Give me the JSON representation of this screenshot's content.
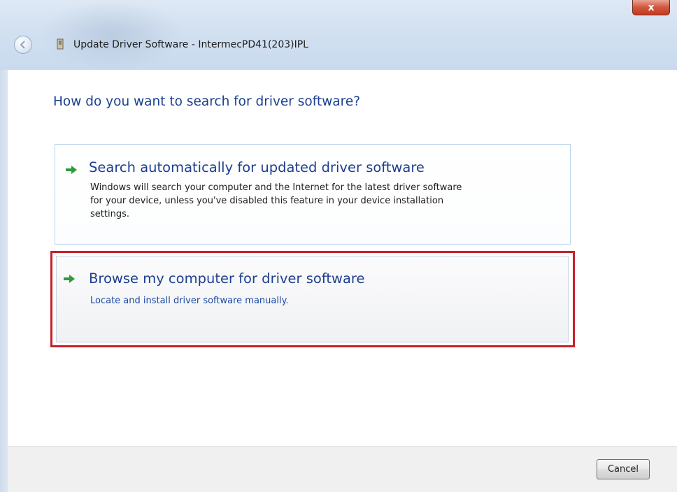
{
  "window": {
    "title": "Update Driver Software - IntermecPD41(203)IPL",
    "close_label": "x"
  },
  "main": {
    "heading": "How do you want to search for driver software?",
    "options": [
      {
        "title": "Search automatically for updated driver software",
        "description_lines": [
          "Windows will search your computer and the Internet for the latest driver software",
          "for your device, unless you've disabled this feature in your device installation",
          "settings."
        ],
        "icon": "green-arrow-icon"
      },
      {
        "title": "Browse my computer for driver software",
        "description": "Locate and install driver software manually.",
        "icon": "green-arrow-icon",
        "highlighted": true
      }
    ]
  },
  "footer": {
    "cancel_label": "Cancel"
  },
  "colors": {
    "heading": "#1b3f8e",
    "option_title": "#1e3f8f",
    "highlight_border": "#c8202a",
    "arrow": "#2e9a3c"
  }
}
